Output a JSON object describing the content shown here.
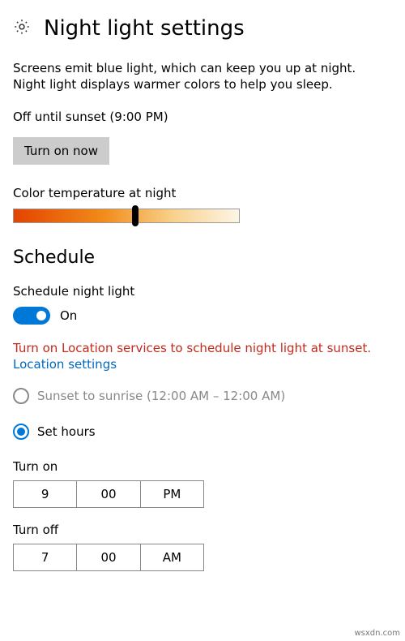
{
  "header": {
    "title": "Night light settings"
  },
  "description": "Screens emit blue light, which can keep you up at night. Night light displays warmer colors to help you sleep.",
  "status": "Off until sunset (9:00 PM)",
  "turn_on_button": "Turn on now",
  "color_temp_label": "Color temperature at night",
  "schedule": {
    "heading": "Schedule",
    "toggle_label": "Schedule night light",
    "toggle_state": "On",
    "error": "Turn on Location services to schedule night light at sunset.",
    "link": "Location settings",
    "option_sunset": "Sunset to sunrise (12:00 AM – 12:00 AM)",
    "option_hours": "Set hours",
    "turn_on_label": "Turn on",
    "turn_on": {
      "hour": "9",
      "minute": "00",
      "ampm": "PM"
    },
    "turn_off_label": "Turn off",
    "turn_off": {
      "hour": "7",
      "minute": "00",
      "ampm": "AM"
    }
  },
  "watermark": "wsxdn.com"
}
